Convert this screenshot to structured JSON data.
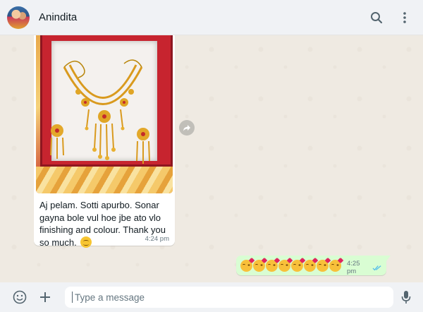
{
  "header": {
    "contact_name": "Anindita",
    "avatar_icon": "avatar",
    "search_icon": "search-icon",
    "menu_icon": "menu-dots-icon"
  },
  "messages": [
    {
      "direction": "incoming",
      "has_image": true,
      "image_description_icon": "jewelry-photo",
      "text": "Aj pelam. Sotti apurbo. Sonar gayna bole vul hoe jbe ato vlo finishing and colour. Thank you so much.",
      "emoji": "smiling-face",
      "time": "4:24 pm"
    },
    {
      "direction": "outgoing",
      "emoji": "face-blowing-kiss",
      "emoji_count": 8,
      "time": "4:25 pm",
      "status": "read"
    }
  ],
  "composer": {
    "placeholder": "Type a message",
    "emoji_icon": "emoji-icon",
    "attach_icon": "plus-icon",
    "mic_icon": "mic-icon"
  },
  "colors": {
    "header_bg": "#f0f2f5",
    "chat_bg": "#efeae2",
    "outgoing_bubble": "#d9fdd3",
    "incoming_bubble": "#ffffff",
    "read_tick": "#53bdeb"
  }
}
